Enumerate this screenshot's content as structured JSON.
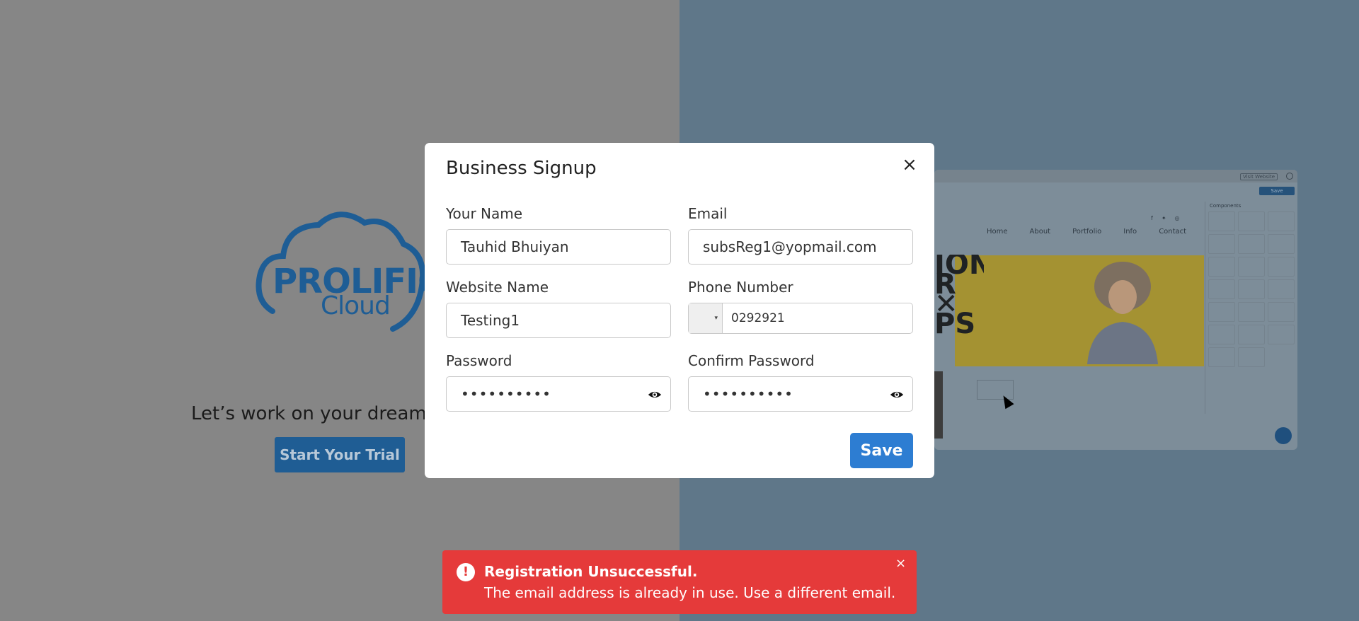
{
  "background": {
    "tagline": "Let’s work on your dream w",
    "trial_button": "Start Your Trial",
    "logo": {
      "line1": "PROLIFIC",
      "line2": "Cloud"
    }
  },
  "mockup": {
    "visit_website": "Visit Website",
    "save": "Save",
    "nav": [
      "Home",
      "About",
      "Portfolio",
      "Info",
      "Contact"
    ],
    "hero_text": "ION R ✕ PS",
    "components_title": "Components"
  },
  "modal": {
    "title": "Business Signup",
    "close": "×",
    "fields": {
      "name": {
        "label": "Your Name",
        "value": "Tauhid Bhuiyan"
      },
      "email": {
        "label": "Email",
        "value": "subsReg1@yopmail.com"
      },
      "website": {
        "label": "Website Name",
        "value": "Testing1"
      },
      "phone": {
        "label": "Phone Number",
        "value": "0292921",
        "flag": "▾"
      },
      "password": {
        "label": "Password",
        "value": "••••••••••"
      },
      "confirm": {
        "label": "Confirm Password",
        "value": "••••••••••"
      }
    },
    "save_button": "Save"
  },
  "toast": {
    "icon": "!",
    "title": "Registration Unsuccessful.",
    "message": "The email address is already in use. Use a different email.",
    "close": "×"
  },
  "colors": {
    "primary": "#2d7dd2",
    "error": "#e53a3a",
    "left_overlay": "#868686",
    "right_overlay": "#5f7789"
  }
}
